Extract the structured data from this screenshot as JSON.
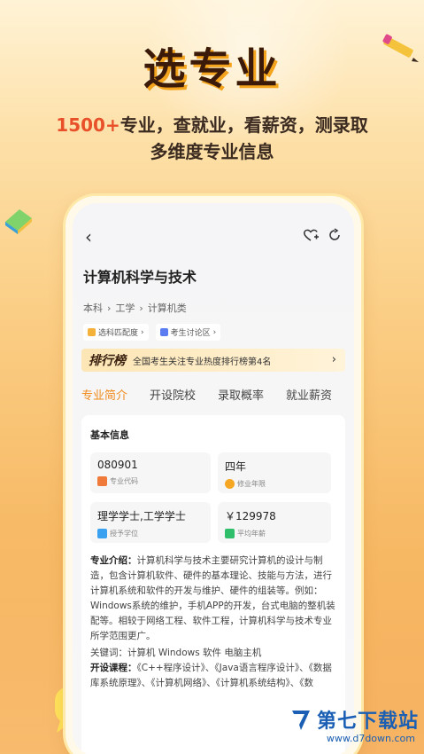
{
  "hero": {
    "title": "选专业",
    "subtitle_accent": "1500+",
    "subtitle_line1_rest": "专业，查就业，看薪资，测录取",
    "subtitle_line2": "多维度专业信息"
  },
  "nav": {
    "back_icon": "chevron-left-icon",
    "favorite_icon": "heart-plus-icon",
    "share_icon": "share-icon"
  },
  "major": {
    "title": "计算机科学与技术",
    "breadcrumb": [
      "本科",
      "工学",
      "计算机类"
    ],
    "chip_match": "选科匹配度",
    "chip_discuss": "考生讨论区"
  },
  "rank": {
    "tag": "排行榜",
    "text": "全国考生关注专业热度排行榜第4名",
    "arrow": "›"
  },
  "tabs": [
    "专业简介",
    "开设院校",
    "录取概率",
    "就业薪资"
  ],
  "active_tab": 0,
  "basic_info": {
    "section_title": "基本信息",
    "items": [
      {
        "value": "080901",
        "label": "专业代码",
        "icon_color": "#f07a3a"
      },
      {
        "value": "四年",
        "label": "修业年限",
        "icon_color": "#f5a623"
      },
      {
        "value": "理学学士,工学学士",
        "label": "授予学位",
        "icon_color": "#3aa0f0"
      },
      {
        "value": "￥129978",
        "label": "平均年薪",
        "icon_color": "#2fbf6a"
      }
    ]
  },
  "intro": {
    "label": "专业介绍：",
    "text": "计算机科学与技术主要研究计算机的设计与制造，包含计算机软件、硬件的基本理论、技能与方法，进行计算机系统和软件的开发与维护、硬件的组装等。例如：Windows系统的维护，手机APP的开发，台式电脑的整机装配等。相较于网络工程、软件工程，计算机科学与技术专业所学范围更广。",
    "keywords": "关键词：计算机  Windows  软件  电脑主机",
    "courses_label": "开设课程：",
    "courses_text": "《C++程序设计》、《Java语言程序设计》、《数据库系统原理》、《计算机网络》、《计算机系统结构》、《数"
  },
  "watermark": {
    "text": "第七下载站",
    "url": "www.d7down.com"
  },
  "colors": {
    "accent": "#f08a1a",
    "subtitle_accent": "#e8502a",
    "watermark": "#1a5fb4"
  }
}
